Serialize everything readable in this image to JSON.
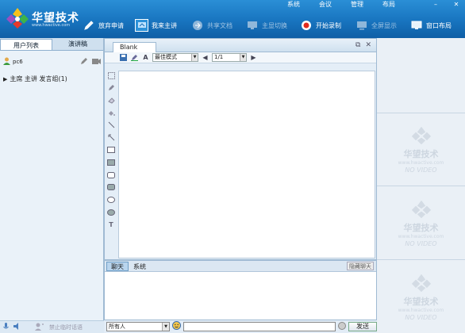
{
  "app": {
    "logo_text": "华望技术",
    "logo_url": "www.hwactive.com",
    "menu": [
      "系统",
      "会议",
      "管理",
      "布局"
    ],
    "window_controls": [
      "minimize-icon",
      "close-icon"
    ]
  },
  "toolbar": [
    {
      "label": "放弃申请",
      "icon": "pen-icon",
      "enabled": true,
      "active": false
    },
    {
      "label": "我来主讲",
      "icon": "presenter-icon",
      "enabled": true,
      "active": true
    },
    {
      "label": "共享文档",
      "icon": "share-doc-icon",
      "enabled": false,
      "active": false
    },
    {
      "label": "主显切换",
      "icon": "display-switch-icon",
      "enabled": false,
      "active": false
    },
    {
      "label": "开始录制",
      "icon": "record-icon",
      "enabled": true,
      "active": false
    },
    {
      "label": "全屏显示",
      "icon": "fullscreen-icon",
      "enabled": false,
      "active": false
    },
    {
      "label": "窗口布局",
      "icon": "window-layout-icon",
      "enabled": true,
      "active": false
    }
  ],
  "left": {
    "tabs": [
      "用户列表",
      "演讲稿"
    ],
    "user": {
      "name": "pc6"
    },
    "group": {
      "label": "主席 主讲 发言组(1)"
    },
    "footer": {
      "private_chat_label": "禁止临时话语"
    }
  },
  "whiteboard": {
    "tab_title": "Blank",
    "zoom_mode": "最佳模式",
    "page": "1/1",
    "tools": [
      "select-icon",
      "pencil-icon",
      "eraser-icon",
      "fill-icon",
      "line-icon",
      "arrow-icon",
      "rect-outline-icon",
      "rect-filled-icon",
      "rounded-rect-outline-icon",
      "rounded-rect-filled-icon",
      "ellipse-outline-icon",
      "ellipse-filled-icon",
      "text-icon"
    ]
  },
  "chat": {
    "tabs": [
      "聊天",
      "系统"
    ],
    "hide_label": "隐藏聊天",
    "target": "所有人",
    "send_label": "发送"
  },
  "video": {
    "slots": [
      {
        "brand": "华望技术",
        "url": "www.hwactive.com",
        "status": "NO VIDEO"
      },
      {
        "brand": "华望技术",
        "url": "www.hwactive.com",
        "status": "NO VIDEO"
      },
      {
        "brand": "华望技术",
        "url": "www.hwactive.com",
        "status": "NO VIDEO"
      }
    ]
  }
}
